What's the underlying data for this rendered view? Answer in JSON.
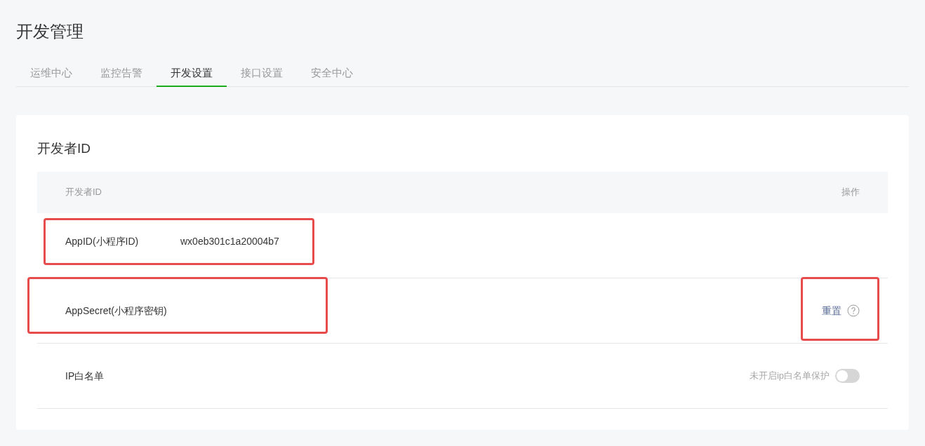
{
  "page_title": "开发管理",
  "tabs": [
    {
      "label": "运维中心",
      "selected": false
    },
    {
      "label": "监控告警",
      "selected": false
    },
    {
      "label": "开发设置",
      "selected": true
    },
    {
      "label": "接口设置",
      "selected": false
    },
    {
      "label": "安全中心",
      "selected": false
    }
  ],
  "section": {
    "title": "开发者ID",
    "columns": [
      "开发者ID",
      "操作"
    ],
    "rows": [
      {
        "kind": "value",
        "label": "AppID(小程序ID)",
        "value": "wx0eb301c1a20004b7",
        "highlighted": true
      },
      {
        "kind": "action",
        "label": "AppSecret(小程序密钥)",
        "action": "重置",
        "highlighted": true,
        "action_highlighted": true
      },
      {
        "kind": "toggle",
        "label": "IP白名单",
        "status": "未开启ip白名单保护",
        "on": false
      }
    ]
  }
}
